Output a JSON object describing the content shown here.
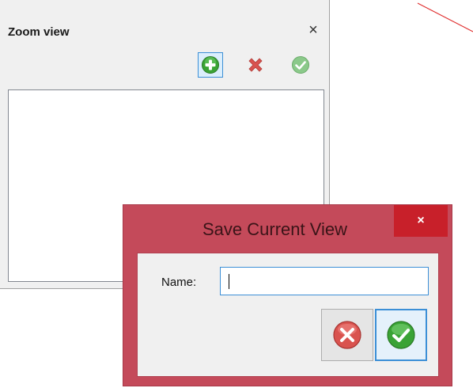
{
  "zoom_panel": {
    "title": "Zoom view",
    "close_glyph": "×",
    "toolbar": [
      {
        "icon": "add-icon",
        "color": "#3aa335"
      },
      {
        "icon": "delete-icon",
        "color": "#d9534f"
      },
      {
        "icon": "apply-icon",
        "color": "#8bc98a"
      }
    ]
  },
  "dialog": {
    "title": "Save Current View",
    "close_glyph": "×",
    "name_label": "Name:",
    "name_value": "",
    "buttons": [
      {
        "icon": "cancel-icon",
        "color": "#d9534f"
      },
      {
        "icon": "ok-icon",
        "color": "#3aa335"
      }
    ]
  },
  "colors": {
    "dialog_frame": "#c44a5a",
    "dialog_close": "#c8202a",
    "focus_border": "#3c8fd6"
  }
}
